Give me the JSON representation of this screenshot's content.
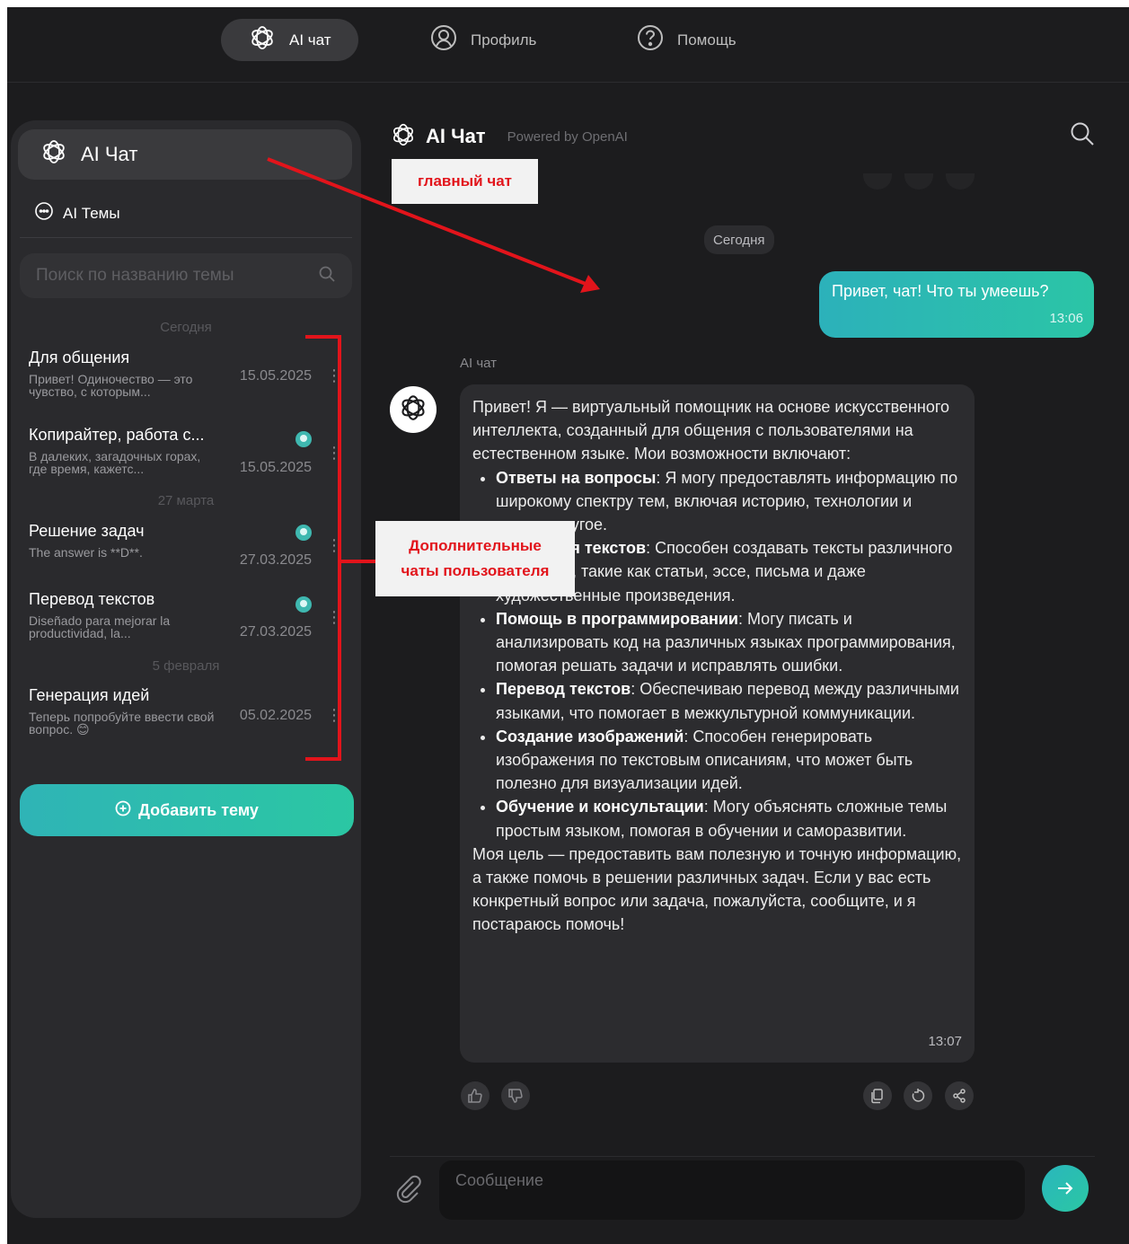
{
  "nav": {
    "items": [
      {
        "label": "AI чат",
        "icon": "openai-icon",
        "active": true
      },
      {
        "label": "Профиль",
        "icon": "user-circle-icon",
        "active": false
      },
      {
        "label": "Помощь",
        "icon": "help-circle-icon",
        "active": false
      }
    ]
  },
  "sidebar": {
    "main_chat_label": "AI Чат",
    "topics_label": "AI Темы",
    "search_placeholder": "Поиск по названию темы",
    "date_groups": [
      "Сегодня",
      "27 марта",
      "5 февраля"
    ],
    "threads": [
      {
        "title": "Для общения",
        "snippet": "Привет! Одиночество — это чувство, с которым...",
        "date": "15.05.2025",
        "badge": false
      },
      {
        "title": "Копирайтер, работа с...",
        "snippet": "В далеких, загадочных горах, где время, кажетс...",
        "date": "15.05.2025",
        "badge": true
      },
      {
        "title": "Решение задач",
        "snippet": "The answer is **D**.",
        "date": "27.03.2025",
        "badge": true
      },
      {
        "title": "Перевод текстов",
        "snippet": "Diseñado para mejorar la productividad, la...",
        "date": "27.03.2025",
        "badge": true
      },
      {
        "title": "Генерация идей",
        "snippet": "Теперь попробуйте ввести свой вопрос. 😊",
        "date": "05.02.2025",
        "badge": false
      }
    ],
    "add_topic_label": "Добавить тему"
  },
  "chat": {
    "title": "AI Чат",
    "powered_by": "Powered by OpenAI",
    "date_divider": "Сегодня",
    "user_message": {
      "text": "Привет, чат! Что ты умеешь?",
      "time": "13:06"
    },
    "bot_name": "AI чат",
    "bot_message": {
      "intro": "Привет! Я — виртуальный помощник на основе искусственного интеллекта, созданный для общения с пользователями на естественном языке. Мои возможности включают:",
      "items": [
        {
          "bold": "Ответы на вопросы",
          "text": ": Я могу предоставлять информацию по широкому спектру тем, включая историю, технологии и многое другое."
        },
        {
          "bold": "Генерация текстов",
          "text": ": Способен создавать тексты различного характера, такие как статьи, эссе, письма и даже художественные произведения."
        },
        {
          "bold": "Помощь в программировании",
          "text": ": Могу писать и анализировать код на различных языках программирования, помогая решать задачи и исправлять ошибки."
        },
        {
          "bold": "Перевод текстов",
          "text": ": Обеспечиваю перевод между различными языками, что помогает в межкультурной коммуникации."
        },
        {
          "bold": "Создание изображений",
          "text": ": Способен генерировать изображения по текстовым описаниям, что может быть полезно для визуализации идей."
        },
        {
          "bold": "Обучение и консультации",
          "text": ": Могу объяснять сложные темы простым языком, помогая в обучении и саморазвитии."
        }
      ],
      "outro": "Моя цель — предоставить вам полезную и точную информацию, а также помочь в решении различных задач. Если у вас есть конкретный вопрос или задача, пожалуйста, сообщите, и я постараюсь помочь!",
      "time": "13:07"
    },
    "composer_placeholder": "Сообщение"
  },
  "annotations": {
    "main_chat": "главный чат",
    "extra_chats_line1": "Дополнительные",
    "extra_chats_line2": "чаты пользователя",
    "color": "#e2141b"
  },
  "colors": {
    "accent_start": "#2cb1ba",
    "accent_end": "#2bc5a6",
    "background": "#1c1c1e",
    "panel": "#2a2a2d"
  }
}
